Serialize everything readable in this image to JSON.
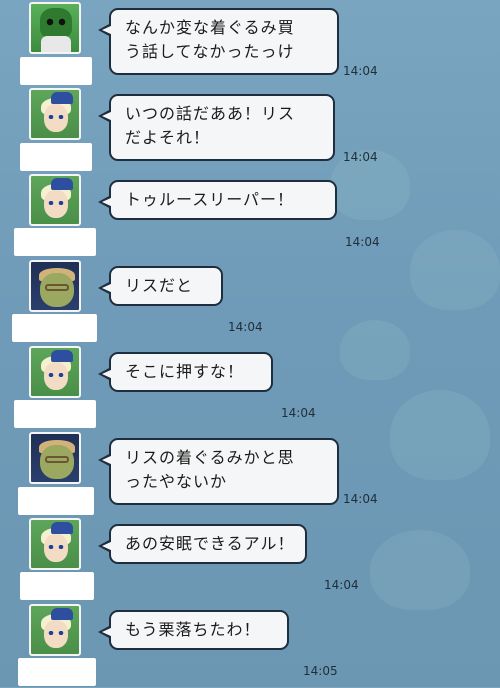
{
  "messages": [
    {
      "avatar": "masked-character-avatar",
      "lines": [
        "なんか変な着ぐるみ買",
        "う話してなかったっけ"
      ],
      "time": "14:04"
    },
    {
      "avatar": "elf-blue-hat-avatar",
      "lines": [
        "いつの話だああ！リス",
        "だよそれ！"
      ],
      "time": "14:04"
    },
    {
      "avatar": "elf-blue-hat-avatar",
      "lines": [
        "トゥルースリーパー！"
      ],
      "time": "14:04"
    },
    {
      "avatar": "ogre-glasses-avatar",
      "lines": [
        "リスだと"
      ],
      "time": "14:04"
    },
    {
      "avatar": "elf-blue-hat-avatar",
      "lines": [
        "そこに押すな！"
      ],
      "time": "14:04"
    },
    {
      "avatar": "ogre-glasses-avatar",
      "lines": [
        "リスの着ぐるみかと思",
        "ったやないか"
      ],
      "time": "14:04"
    },
    {
      "avatar": "elf-blue-hat-avatar",
      "lines": [
        "あの安眠できるアル！"
      ],
      "time": "14:04"
    },
    {
      "avatar": "elf-blue-hat-avatar",
      "lines": [
        "もう栗落ちたわ！"
      ],
      "time": "14:05"
    }
  ],
  "colors": {
    "background": "#6f9bb8",
    "bubble": "#f5f6f7",
    "bubble_border": "#1e2e3e"
  }
}
